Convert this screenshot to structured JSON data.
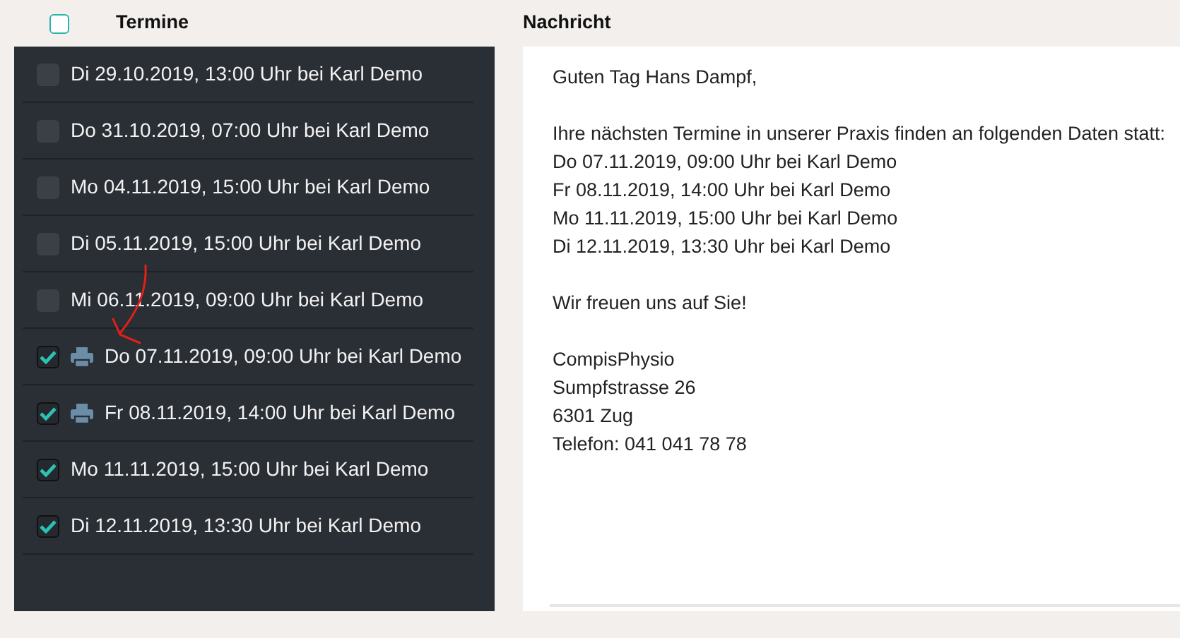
{
  "header": {
    "all_checked": false,
    "termine_label": "Termine",
    "nachricht_label": "Nachricht"
  },
  "appointments": [
    {
      "text": "Di 29.10.2019, 13:00 Uhr bei Karl Demo",
      "checked": false,
      "printed": false
    },
    {
      "text": "Do 31.10.2019, 07:00 Uhr bei Karl Demo",
      "checked": false,
      "printed": false
    },
    {
      "text": "Mo 04.11.2019, 15:00 Uhr bei Karl Demo",
      "checked": false,
      "printed": false
    },
    {
      "text": "Di 05.11.2019, 15:00 Uhr bei Karl Demo",
      "checked": false,
      "printed": false
    },
    {
      "text": "Mi 06.11.2019, 09:00 Uhr bei Karl Demo",
      "checked": false,
      "printed": false
    },
    {
      "text": "Do 07.11.2019, 09:00 Uhr bei Karl Demo",
      "checked": true,
      "printed": true
    },
    {
      "text": "Fr 08.11.2019, 14:00 Uhr bei Karl Demo",
      "checked": true,
      "printed": true
    },
    {
      "text": "Mo 11.11.2019, 15:00 Uhr bei Karl Demo",
      "checked": true,
      "printed": false
    },
    {
      "text": "Di 12.11.2019, 13:30 Uhr bei Karl Demo",
      "checked": true,
      "printed": false
    }
  ],
  "message": {
    "paragraphs": [
      [
        "Guten Tag Hans Dampf,"
      ],
      [
        "Ihre nächsten Termine in unserer Praxis finden an folgenden Daten statt:",
        "Do 07.11.2019, 09:00 Uhr bei Karl Demo",
        "Fr 08.11.2019, 14:00 Uhr bei Karl Demo",
        "Mo 11.11.2019, 15:00 Uhr bei Karl Demo",
        "Di 12.11.2019, 13:30 Uhr bei Karl Demo"
      ],
      [
        "Wir freuen uns auf Sie!"
      ],
      [
        "CompisPhysio",
        "Sumpfstrasse 26",
        "6301 Zug",
        "Telefon: 041 041 78 78"
      ]
    ]
  }
}
